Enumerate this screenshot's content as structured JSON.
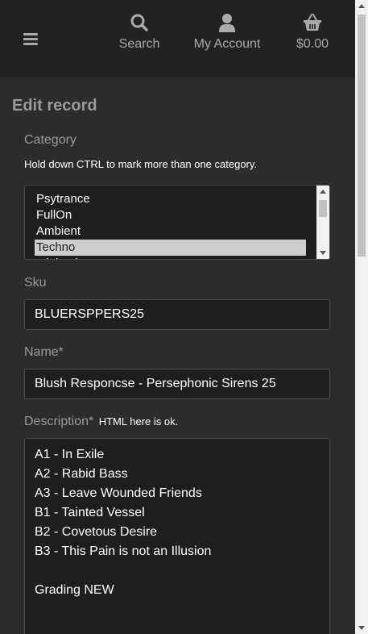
{
  "header": {
    "search_label": "Search",
    "account_label": "My Account",
    "cart_label": "$0.00"
  },
  "form": {
    "title": "Edit record",
    "category": {
      "label": "Category",
      "help": "Hold down CTRL to mark more than one category.",
      "options": [
        "Psytrance",
        "FullOn",
        "Ambient",
        "Techno",
        "Minimal"
      ],
      "selected": "Techno"
    },
    "sku": {
      "label": "Sku",
      "value": "BLUERSPPERS25"
    },
    "name": {
      "label": "Name*",
      "value": "Blush Responcse - Persephonic Sirens 25"
    },
    "description": {
      "label": "Description*",
      "note": "HTML here is ok.",
      "lines": [
        "A1 - In Exile",
        "A2 - Rabid Bass",
        "A3 - Leave Wounded Friends",
        "B1 - Tainted Vessel",
        "B2 - Covetous Desire",
        "B3 - This Pain is not an Illusion",
        "",
        "Grading NEW"
      ]
    }
  },
  "icons": {
    "menu": "hamburger-menu-icon",
    "search": "search-icon",
    "account": "user-icon",
    "cart": "basket-icon"
  },
  "colors": {
    "background": "#2c2c2c",
    "header": "#222222",
    "muted_text": "#9a9a9a",
    "input_bg": "#1e1e1e",
    "selected_option": "#cecece"
  }
}
